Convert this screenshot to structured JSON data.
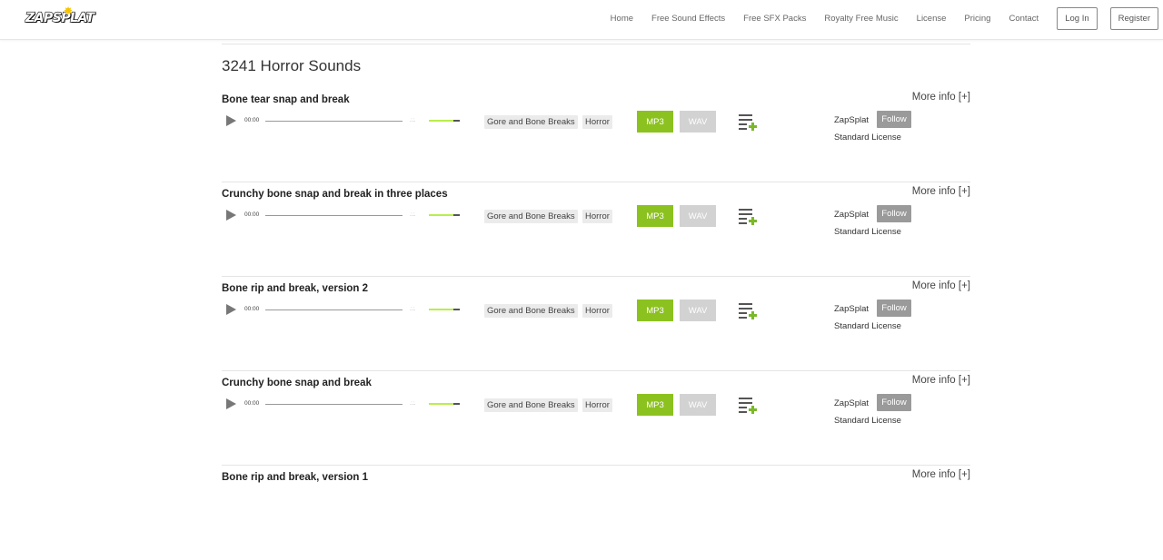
{
  "header": {
    "logo_text": "ZAPSPLAT",
    "nav": [
      "Home",
      "Free Sound Effects",
      "Free SFX Packs",
      "Royalty Free Music",
      "License",
      "Pricing",
      "Contact"
    ],
    "login_label": "Log In",
    "register_label": "Register"
  },
  "page": {
    "title": "3241 Horror Sounds"
  },
  "common": {
    "more_info": "More info [+]",
    "time": "00:00",
    "mp3_label": "MP3",
    "wav_label": "WAV",
    "follow_label": "Follow",
    "colors": {
      "accent_green": "#8cc21f",
      "volume_green": "#b9ee4a",
      "wav_gray": "#d2d2d2",
      "follow_gray": "#9a9a9a"
    }
  },
  "sounds": [
    {
      "title": "Bone tear snap and break",
      "tags": [
        "Gore and Bone Breaks",
        "Horror"
      ],
      "author": "ZapSplat",
      "license": "Standard License"
    },
    {
      "title": "Crunchy bone snap and break in three places",
      "tags": [
        "Gore and Bone Breaks",
        "Horror"
      ],
      "author": "ZapSplat",
      "license": "Standard License"
    },
    {
      "title": "Bone rip and break, version 2",
      "tags": [
        "Gore and Bone Breaks",
        "Horror"
      ],
      "author": "ZapSplat",
      "license": "Standard License"
    },
    {
      "title": "Crunchy bone snap and break",
      "tags": [
        "Gore and Bone Breaks",
        "Horror"
      ],
      "author": "ZapSplat",
      "license": "Standard License"
    },
    {
      "title": "Bone rip and break, version 1",
      "tags": [],
      "author": "",
      "license": ""
    }
  ]
}
